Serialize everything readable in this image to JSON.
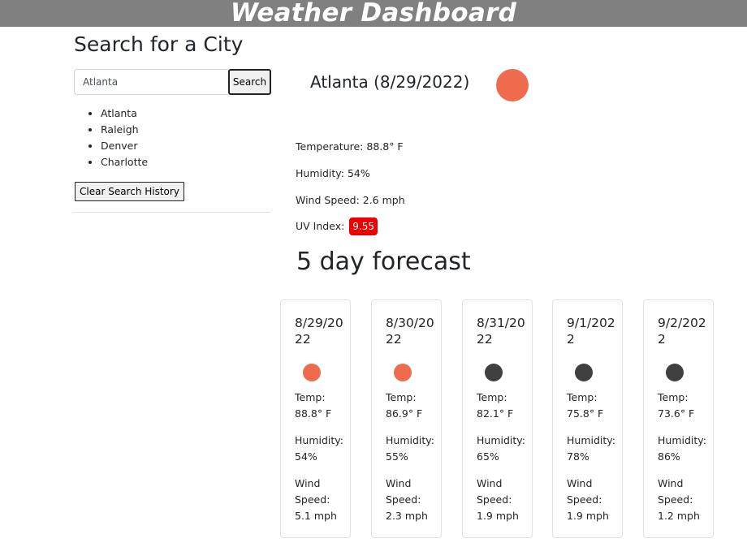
{
  "header": {
    "title": "Weather Dashboard"
  },
  "search": {
    "title": "Search for a City",
    "input_value": "Atlanta",
    "button_label": "Search",
    "history": [
      "Atlanta",
      "Raleigh",
      "Denver",
      "Charlotte"
    ],
    "clear_label": "Clear Search History"
  },
  "current": {
    "title": "Atlanta (8/29/2022)",
    "icon": "sun-icon",
    "icon_color": "#ee6c4d",
    "temperature": "Temperature: 88.8° F",
    "humidity": "Humidity: 54%",
    "wind": "Wind Speed: 2.6 mph",
    "uv_label": "UV Index:",
    "uv_value": "9.55",
    "uv_color": "#ee0000"
  },
  "forecast": {
    "title": "5 day forecast",
    "days": [
      {
        "date": "8/29/2022",
        "icon": "sun-icon",
        "icon_color": "#ee6c4d",
        "temp_label": "Temp:",
        "temp": "88.8° F",
        "humidity_label": "Humidity:",
        "humidity": "54%",
        "wind_label": "Wind Speed:",
        "wind": "5.1 mph"
      },
      {
        "date": "8/30/2022",
        "icon": "sun-icon",
        "icon_color": "#ee6c4d",
        "temp_label": "Temp:",
        "temp": "86.9° F",
        "humidity_label": "Humidity:",
        "humidity": "55%",
        "wind_label": "Wind Speed:",
        "wind": "2.3 mph"
      },
      {
        "date": "8/31/2022",
        "icon": "cloud-icon",
        "icon_color": "#404040",
        "temp_label": "Temp:",
        "temp": "82.1° F",
        "humidity_label": "Humidity:",
        "humidity": "65%",
        "wind_label": "Wind Speed:",
        "wind": "1.9 mph"
      },
      {
        "date": "9/1/2022",
        "icon": "cloud-icon",
        "icon_color": "#404040",
        "temp_label": "Temp:",
        "temp": "75.8° F",
        "humidity_label": "Humidity:",
        "humidity": "78%",
        "wind_label": "Wind Speed:",
        "wind": "1.9 mph"
      },
      {
        "date": "9/2/2022",
        "icon": "cloud-icon",
        "icon_color": "#404040",
        "temp_label": "Temp:",
        "temp": "73.6° F",
        "humidity_label": "Humidity:",
        "humidity": "86%",
        "wind_label": "Wind Speed:",
        "wind": "1.2 mph"
      }
    ]
  }
}
